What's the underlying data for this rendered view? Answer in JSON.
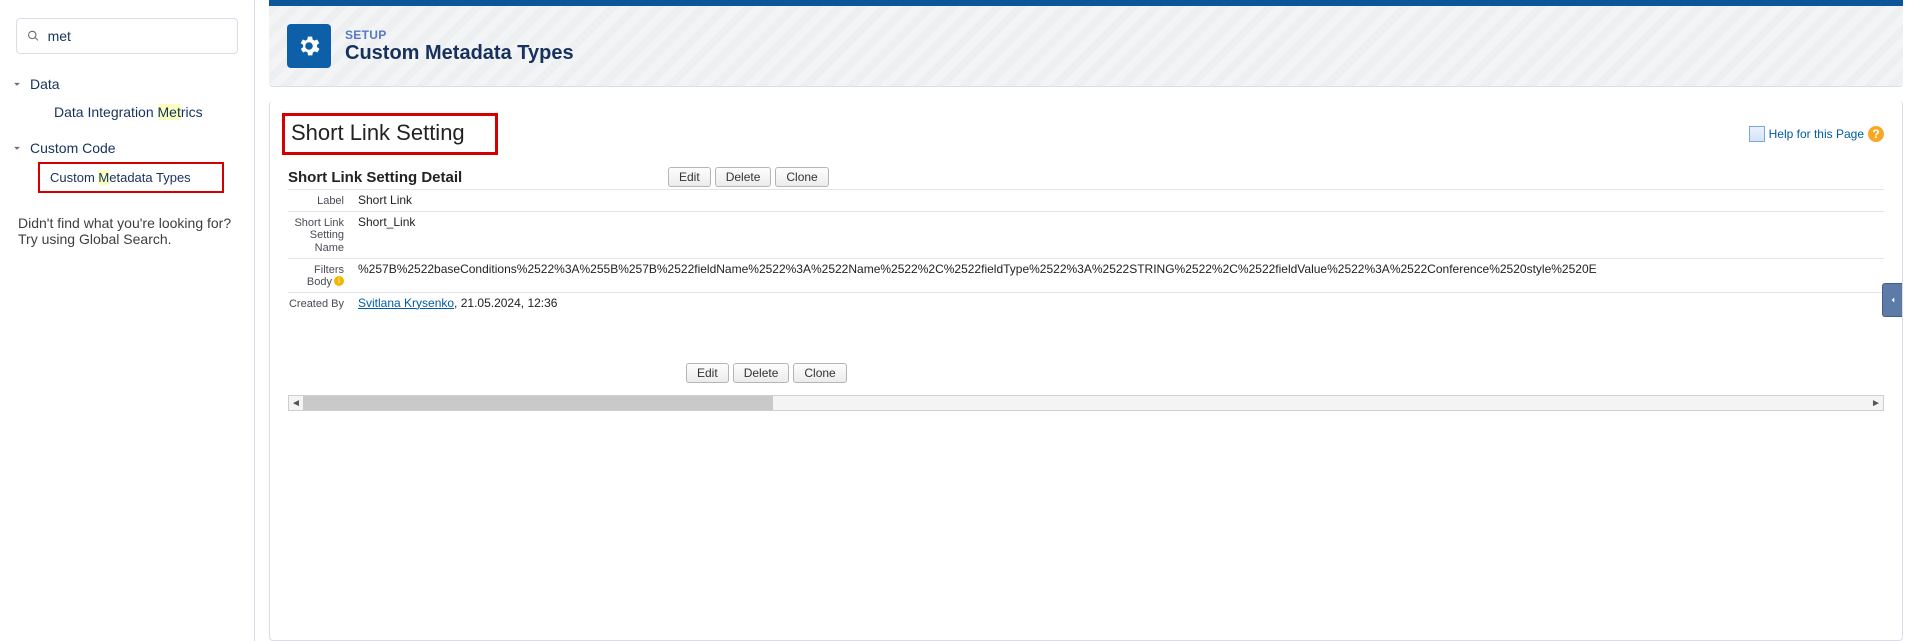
{
  "sidebar": {
    "search_value": "met",
    "groups": [
      {
        "label": "Data",
        "items": [
          {
            "label_pre": "Data Integration ",
            "label_hl": "Met",
            "label_post": "rics",
            "active": false
          }
        ]
      },
      {
        "label": "Custom Code",
        "items": [
          {
            "label_pre": "Custom ",
            "label_hl": "M",
            "label_post": "etadata Types",
            "active": true
          }
        ]
      }
    ],
    "not_found_line1": "Didn't find what you're looking for?",
    "not_found_line2": "Try using Global Search."
  },
  "header": {
    "eyebrow": "SETUP",
    "title": "Custom Metadata Types"
  },
  "page": {
    "title": "Short Link Setting",
    "help_label": "Help for this Page"
  },
  "detail": {
    "section_title": "Short Link Setting Detail",
    "buttons": {
      "edit": "Edit",
      "delete": "Delete",
      "clone": "Clone"
    },
    "rows": {
      "label": {
        "label": "Label",
        "value": "Short Link"
      },
      "name": {
        "label": "Short Link Setting Name",
        "value": "Short_Link"
      },
      "filters": {
        "label": "Filters Body",
        "value": "%257B%2522baseConditions%2522%3A%255B%257B%2522fieldName%2522%3A%2522Name%2522%2C%2522fieldType%2522%3A%2522STRING%2522%2C%2522fieldValue%2522%3A%2522Conference%2520style%2520E"
      },
      "created": {
        "label": "Created By",
        "user": "Svitlana Krysenko",
        "datetime": ", 21.05.2024, 12:36"
      }
    }
  }
}
